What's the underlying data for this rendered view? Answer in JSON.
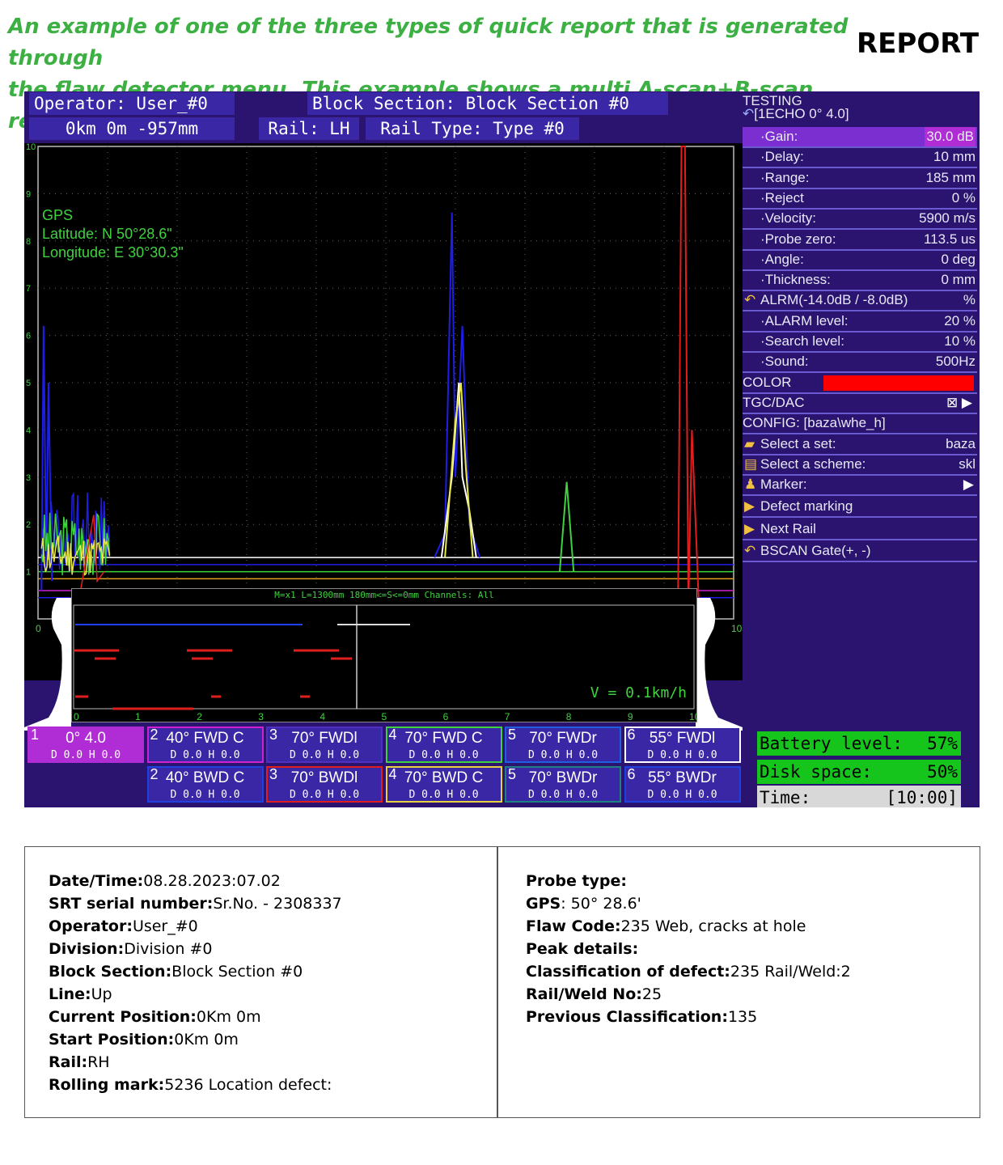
{
  "caption": {
    "line1": "An example of one of the three types of quick report that is generated through",
    "line2": "the flaw detector menu. This example shows a multi A-scan+B-scan report."
  },
  "report_title": "REPORT",
  "screen": {
    "header": {
      "operator": "Operator: User_#0",
      "block_section": "Block Section: Block Section #0",
      "position": "0km   0m -957mm",
      "rail": "Rail: LH",
      "rail_type": "Rail Type: Type #0"
    },
    "gps": {
      "title": "GPS",
      "latitude": "Latitude: N 50°28.6\"",
      "longitude": "Longitude: E 30°30.3\""
    },
    "ascan": {
      "y_ticks": [
        "10",
        "9",
        "8",
        "7",
        "6",
        "5",
        "4",
        "3",
        "2",
        "1"
      ],
      "x_ticks": [
        "0",
        "1",
        "2",
        "3",
        "4",
        "5",
        "6",
        "7",
        "8",
        "9",
        "10"
      ],
      "trace_colors": [
        "#1e1ee6",
        "#3fd23f",
        "#e8e84a",
        "#e01e1e",
        "#ffffff",
        "#e0a020",
        "#d020d0"
      ]
    },
    "panel": {
      "testing_label": "TESTING",
      "mode_label": "[1ECHO  0° 4.0]",
      "rows": [
        {
          "label": "·Gain:",
          "value": "30.0 dB",
          "selected": true
        },
        {
          "label": "·Delay:",
          "value": "10 mm"
        },
        {
          "label": "·Range:",
          "value": "185 mm"
        },
        {
          "label": "·Reject",
          "value": "0 %"
        },
        {
          "label": "·Velocity:",
          "value": "5900 m/s"
        },
        {
          "label": "·Probe zero:",
          "value": "113.5 us"
        },
        {
          "label": "·Angle:",
          "value": "0 deg"
        },
        {
          "label": "·Thickness:",
          "value": "0 mm"
        }
      ],
      "alarm_label": "ALRM(-14.0dB / -8.0dB)",
      "alarm_value": "%",
      "alarm_rows": [
        {
          "label": "·ALARM level:",
          "value": "20 %"
        },
        {
          "label": "·Search level:",
          "value": "10 %"
        },
        {
          "label": "·Sound:",
          "value": "500Hz"
        }
      ],
      "color_label": "COLOR",
      "color_value": "#ff0000",
      "tgc_label": "TGC/DAC",
      "config_label": "CONFIG: [baza\\whe_h]",
      "select_set_label": "Select a set:",
      "select_set_value": "baza",
      "select_scheme_label": "Select a scheme:",
      "select_scheme_value": "skl",
      "marker_label": "Marker:",
      "defect_marking_label": "Defect marking",
      "next_rail_label": "Next Rail",
      "bscan_gate_label": "BSCAN Gate(+, -)"
    },
    "bscan": {
      "header": "M=x1  L=1300mm 180mm<=S<=0mm Channels: All",
      "speed": "V = 0.1km/h",
      "x_ticks": [
        "0",
        "1",
        "2",
        "3",
        "4",
        "5",
        "6",
        "7",
        "8",
        "9",
        "10"
      ]
    },
    "channels_top": [
      {
        "num": "1",
        "name": "0° 4.0",
        "dh": "D  0.0 H  0.0",
        "color": "#b02dd5",
        "active": true
      },
      {
        "num": "2",
        "name": "40° FWD C",
        "dh": "D  0.0 H  0.0",
        "color": "#d020d0"
      },
      {
        "num": "3",
        "name": "70° FWDl",
        "dh": "D  0.0 H  0.0",
        "color": "#5030c0"
      },
      {
        "num": "4",
        "name": "70° FWD C",
        "dh": "D  0.0 H  0.0",
        "color": "#3fd23f"
      },
      {
        "num": "5",
        "name": "70° FWDr",
        "dh": "D  0.0 H  0.0",
        "color": "#2060e0"
      },
      {
        "num": "6",
        "name": "55° FWDl",
        "dh": "D  0.0 H  0.0",
        "color": "#ffffff"
      }
    ],
    "channels_bottom": [
      {
        "num": "2",
        "name": "40° BWD C",
        "dh": "D  0.0 H  0.0",
        "color": "#2040e0"
      },
      {
        "num": "3",
        "name": "70° BWDl",
        "dh": "D  0.0 H  0.0",
        "color": "#e01e1e"
      },
      {
        "num": "4",
        "name": "70° BWD C",
        "dh": "D  0.0 H  0.0",
        "color": "#e8d040"
      },
      {
        "num": "5",
        "name": "70° BWDr",
        "dh": "D  0.0 H  0.0",
        "color": "#1e8080"
      },
      {
        "num": "6",
        "name": "55° BWDr",
        "dh": "D  0.0 H  0.0",
        "color": "#2040e0"
      }
    ],
    "status": {
      "battery_label": "Battery level:",
      "battery_value": "57%",
      "disk_label": "Disk space:",
      "disk_value": "50%",
      "time_label": "Time:",
      "time_value": "[10:00]"
    }
  },
  "info": {
    "left": [
      {
        "k": "Date/Time:",
        "v": "08.28.2023:07.02"
      },
      {
        "k": "SRT serial number:",
        "v": "Sr.No. - 2308337"
      },
      {
        "k": "Operator:",
        "v": "User_#0"
      },
      {
        "k": "Division:",
        "v": "Division #0"
      },
      {
        "k": "Block Section:",
        "v": "Block Section #0"
      },
      {
        "k": "Line:",
        "v": "Up"
      },
      {
        "k": "Current Position:",
        "v": "0Km 0m"
      },
      {
        "k": "Start Position:",
        "v": "0Km 0m"
      },
      {
        "k": "Rail:",
        "v": "RH"
      },
      {
        "k": "Rolling mark:",
        "v": "5236 Location defect:"
      }
    ],
    "right": [
      {
        "k": "Probe type:",
        "v": ""
      },
      {
        "k": "GPS",
        "v": ": 50° 28.6'"
      },
      {
        "k": "Flaw Code:",
        "v": "235 Web, cracks at hole"
      },
      {
        "k": "Peak details:",
        "v": ""
      },
      {
        "k": "Classification of defect:",
        "v": "235 Rail/Weld:2"
      },
      {
        "k": "Rail/Weld No:",
        "v": "25"
      },
      {
        "k": "Previous Classification:",
        "v": "135"
      }
    ]
  }
}
